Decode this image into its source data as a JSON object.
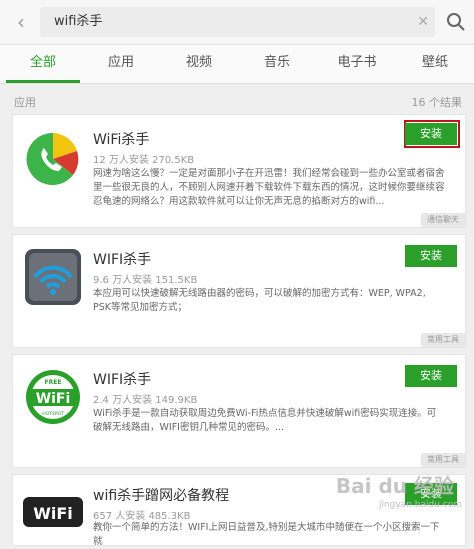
{
  "search": {
    "query": "wifi杀手"
  },
  "tabs": [
    {
      "label": "全部"
    },
    {
      "label": "应用"
    },
    {
      "label": "视频"
    },
    {
      "label": "音乐"
    },
    {
      "label": "电子书"
    },
    {
      "label": "壁纸"
    }
  ],
  "section": {
    "label": "应用",
    "count": "16 个结果"
  },
  "apps": [
    {
      "title": "WiFi杀手",
      "meta": "12 万人安装  270.5KB",
      "desc": "网速为啥这么慢？一定是对面那小子在开迅雷！我们经常会碰到一些办公室或者宿舍里一些很无良的人，不顾别人网速开着下载软件下载东西的情况，这时候你要继续容忍龟速的网络么？用这款软件就可以让你无声无息的掐断对方的wifi...",
      "install_label": "安装",
      "tag": "通信聊天"
    },
    {
      "title": "WIFI杀手",
      "meta": "9.6 万人安装  151.5KB",
      "desc": "本应用可以快速破解无线路由器的密码，可以破解的加密方式有：WEP, WPA2, PSK等常见加密方式；",
      "install_label": "安装",
      "tag": "常用工具"
    },
    {
      "title": "WIFI杀手",
      "meta": "2.4 万人安装  149.9KB",
      "desc": "WiFi杀手是一款自动获取周边免费Wi-Fi热点信息并快速破解wifi密码实现连接。可破解无线路由，WIFI密钥几种常见的密码。...",
      "install_label": "安装",
      "tag": "常用工具"
    },
    {
      "title": "wifi杀手蹭网必备教程",
      "meta": "657 人安装  485.3KB",
      "desc": "教你一个简单的方法！WIFI上网日益普及,特别是大城市中随便在一个小区搜索一下就",
      "install_label": "安装"
    }
  ],
  "icons": {
    "wifi_logo_text": "WiFi",
    "free_badge": "FREE",
    "hotspot_text": "HOTSPOT"
  },
  "watermark": {
    "text": "Bai du 经验",
    "sub": "jingyan.baidu.com"
  },
  "colors": {
    "accent": "#2aa02a",
    "highlight": "#c0141c"
  }
}
